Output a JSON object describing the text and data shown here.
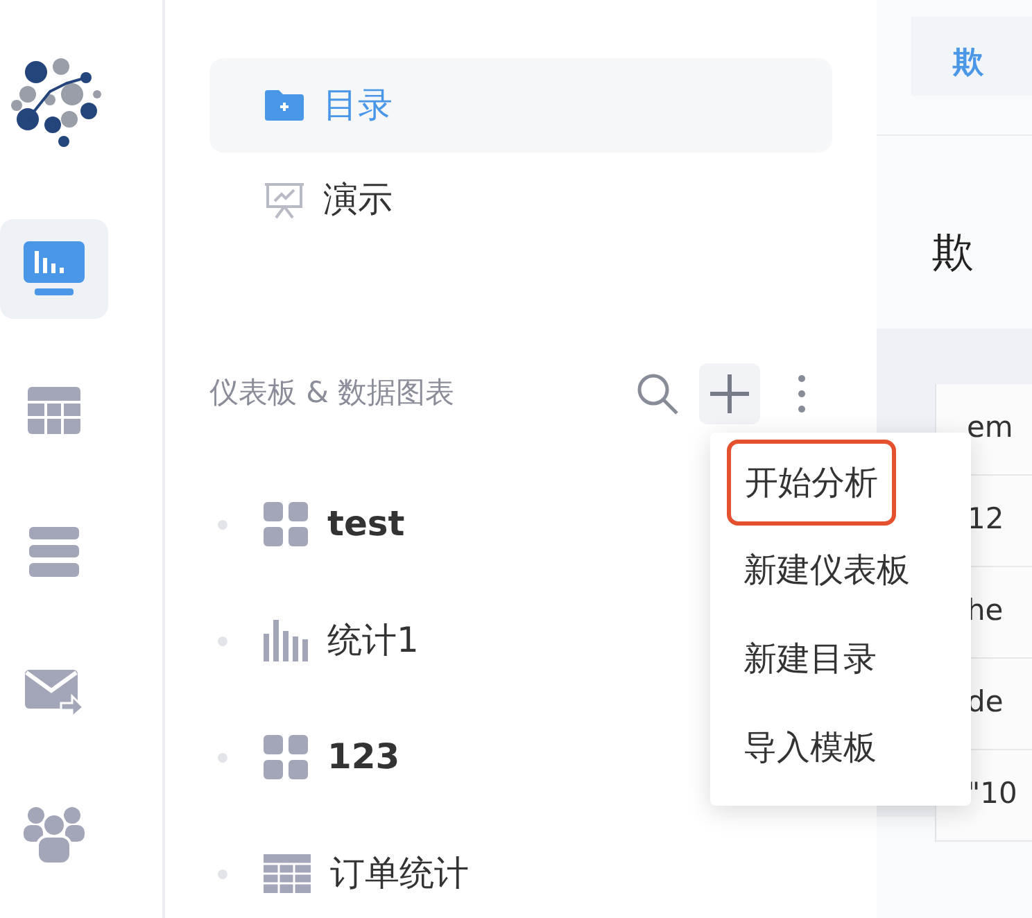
{
  "rail": {
    "items": [
      {
        "kind": "dashboard",
        "selected": true
      },
      {
        "kind": "table",
        "selected": false
      },
      {
        "kind": "list",
        "selected": false
      },
      {
        "kind": "mail",
        "selected": false
      },
      {
        "kind": "users",
        "selected": false
      }
    ]
  },
  "nav": [
    {
      "kind": "folder",
      "label": "目录",
      "selected": true
    },
    {
      "kind": "presentation",
      "label": "演示",
      "selected": false
    }
  ],
  "section": {
    "title": "仪表板 & 数据图表"
  },
  "tree": [
    {
      "kind": "dashboard",
      "label": "test"
    },
    {
      "kind": "chart",
      "label": "统计1"
    },
    {
      "kind": "dashboard",
      "label": "123"
    },
    {
      "kind": "table",
      "label": "订单统计"
    }
  ],
  "menu": [
    {
      "label": "开始分析",
      "highlighted": true
    },
    {
      "label": "新建仪表板",
      "highlighted": false
    },
    {
      "label": "新建目录",
      "highlighted": false
    },
    {
      "label": "导入模板",
      "highlighted": false
    }
  ],
  "content": {
    "tab": "欺",
    "heading": "欺",
    "cells": [
      "em",
      "12",
      "he",
      "de",
      "\"10"
    ]
  }
}
